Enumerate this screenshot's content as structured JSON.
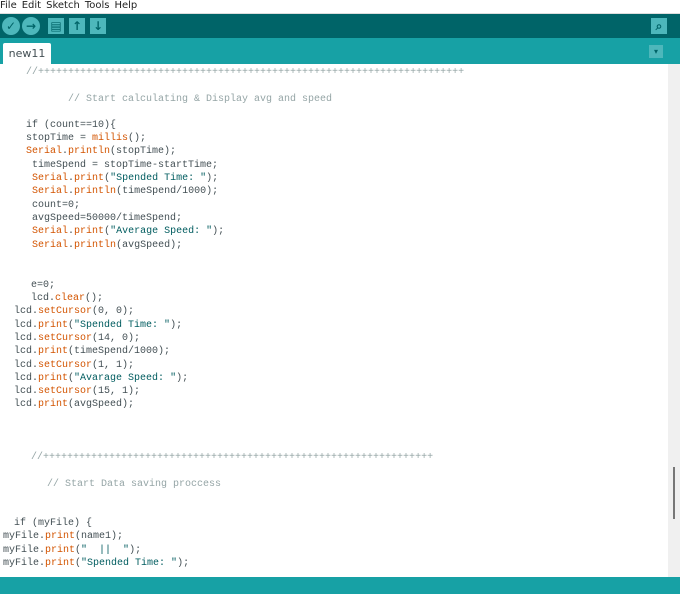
{
  "menu": [
    "File",
    "Edit",
    "Sketch",
    "Tools",
    "Help"
  ],
  "toolbar": {
    "verify": "✓",
    "upload": "→",
    "new": "▤",
    "open": "↑",
    "save": "↓",
    "serial_monitor": "⌕"
  },
  "tab": {
    "label": "new11",
    "menu_icon": "▾"
  },
  "code": [
    [
      [
        "//+++++++++++++++++++++++++++++++++++++++++++++++++++++++++++++++++++++++",
        "cm"
      ]
    ],
    [
      [
        "// Start calculating & Display avg and speed",
        "cm"
      ]
    ],
    [
      [
        "if (count==10){",
        ""
      ]
    ],
    [
      [
        "stopTime = ",
        ""
      ],
      [
        "millis",
        "kw"
      ],
      [
        "();",
        ""
      ]
    ],
    [
      [
        "Serial",
        "kw"
      ],
      [
        ".",
        ""
      ],
      [
        "println",
        "kw"
      ],
      [
        "(stopTime);",
        ""
      ]
    ],
    [
      [
        " timeSpend = stopTime-startTime;",
        ""
      ]
    ],
    [
      [
        " ",
        ""
      ],
      [
        "Serial",
        "kw"
      ],
      [
        ".",
        ""
      ],
      [
        "print",
        "kw"
      ],
      [
        "(",
        ""
      ],
      [
        "\"Spended Time: \"",
        "str"
      ],
      [
        ");",
        ""
      ]
    ],
    [
      [
        " ",
        ""
      ],
      [
        "Serial",
        "kw"
      ],
      [
        ".",
        ""
      ],
      [
        "println",
        "kw"
      ],
      [
        "(timeSpend/1000);",
        ""
      ]
    ],
    [
      [
        " count=0;",
        ""
      ]
    ],
    [
      [
        " avgSpeed=50000/timeSpend;",
        ""
      ]
    ],
    [
      [
        " ",
        ""
      ],
      [
        "Serial",
        "kw"
      ],
      [
        ".",
        ""
      ],
      [
        "print",
        "kw"
      ],
      [
        "(",
        ""
      ],
      [
        "\"Average Speed: \"",
        "str"
      ],
      [
        ");",
        ""
      ]
    ],
    [
      [
        " ",
        ""
      ],
      [
        "Serial",
        "kw"
      ],
      [
        ".",
        ""
      ],
      [
        "println",
        "kw"
      ],
      [
        "(avgSpeed);",
        ""
      ]
    ],
    [
      [
        "e=0;",
        ""
      ]
    ],
    [
      [
        "lcd.",
        ""
      ],
      [
        "clear",
        "kw"
      ],
      [
        "();",
        ""
      ]
    ],
    [
      [
        "lcd.",
        ""
      ],
      [
        "setCursor",
        "kw"
      ],
      [
        "(0, 0);",
        ""
      ]
    ],
    [
      [
        "lcd.",
        ""
      ],
      [
        "print",
        "kw"
      ],
      [
        "(",
        ""
      ],
      [
        "\"Spended Time: \"",
        "str"
      ],
      [
        ");",
        ""
      ]
    ],
    [
      [
        "lcd.",
        ""
      ],
      [
        "setCursor",
        "kw"
      ],
      [
        "(14, 0);",
        ""
      ]
    ],
    [
      [
        "lcd.",
        ""
      ],
      [
        "print",
        "kw"
      ],
      [
        "(timeSpend/1000);",
        ""
      ]
    ],
    [
      [
        "lcd.",
        ""
      ],
      [
        "setCursor",
        "kw"
      ],
      [
        "(1, 1);",
        ""
      ]
    ],
    [
      [
        "lcd.",
        ""
      ],
      [
        "print",
        "kw"
      ],
      [
        "(",
        ""
      ],
      [
        "\"Avarage Speed: \"",
        "str"
      ],
      [
        ");",
        ""
      ]
    ],
    [
      [
        "lcd.",
        ""
      ],
      [
        "setCursor",
        "kw"
      ],
      [
        "(15, 1);",
        ""
      ]
    ],
    [
      [
        "lcd.",
        ""
      ],
      [
        "print",
        "kw"
      ],
      [
        "(avgSpeed);",
        ""
      ]
    ],
    [
      [
        "//+++++++++++++++++++++++++++++++++++++++++++++++++++++++++++++++++",
        "cm"
      ]
    ],
    [
      [
        "// Start Data saving proccess",
        "cm"
      ]
    ],
    [
      [
        "if (myFile) {",
        ""
      ]
    ],
    [
      [
        "myFile.",
        ""
      ],
      [
        "print",
        "kw"
      ],
      [
        "(name1);",
        ""
      ]
    ],
    [
      [
        "myFile.",
        ""
      ],
      [
        "print",
        "kw"
      ],
      [
        "(",
        ""
      ],
      [
        "\"  ||  \"",
        "str"
      ],
      [
        ");",
        ""
      ]
    ],
    [
      [
        "myFile.",
        ""
      ],
      [
        "print",
        "kw"
      ],
      [
        "(",
        ""
      ],
      [
        "\"Spended Time: \"",
        "str"
      ],
      [
        ");",
        ""
      ]
    ]
  ]
}
